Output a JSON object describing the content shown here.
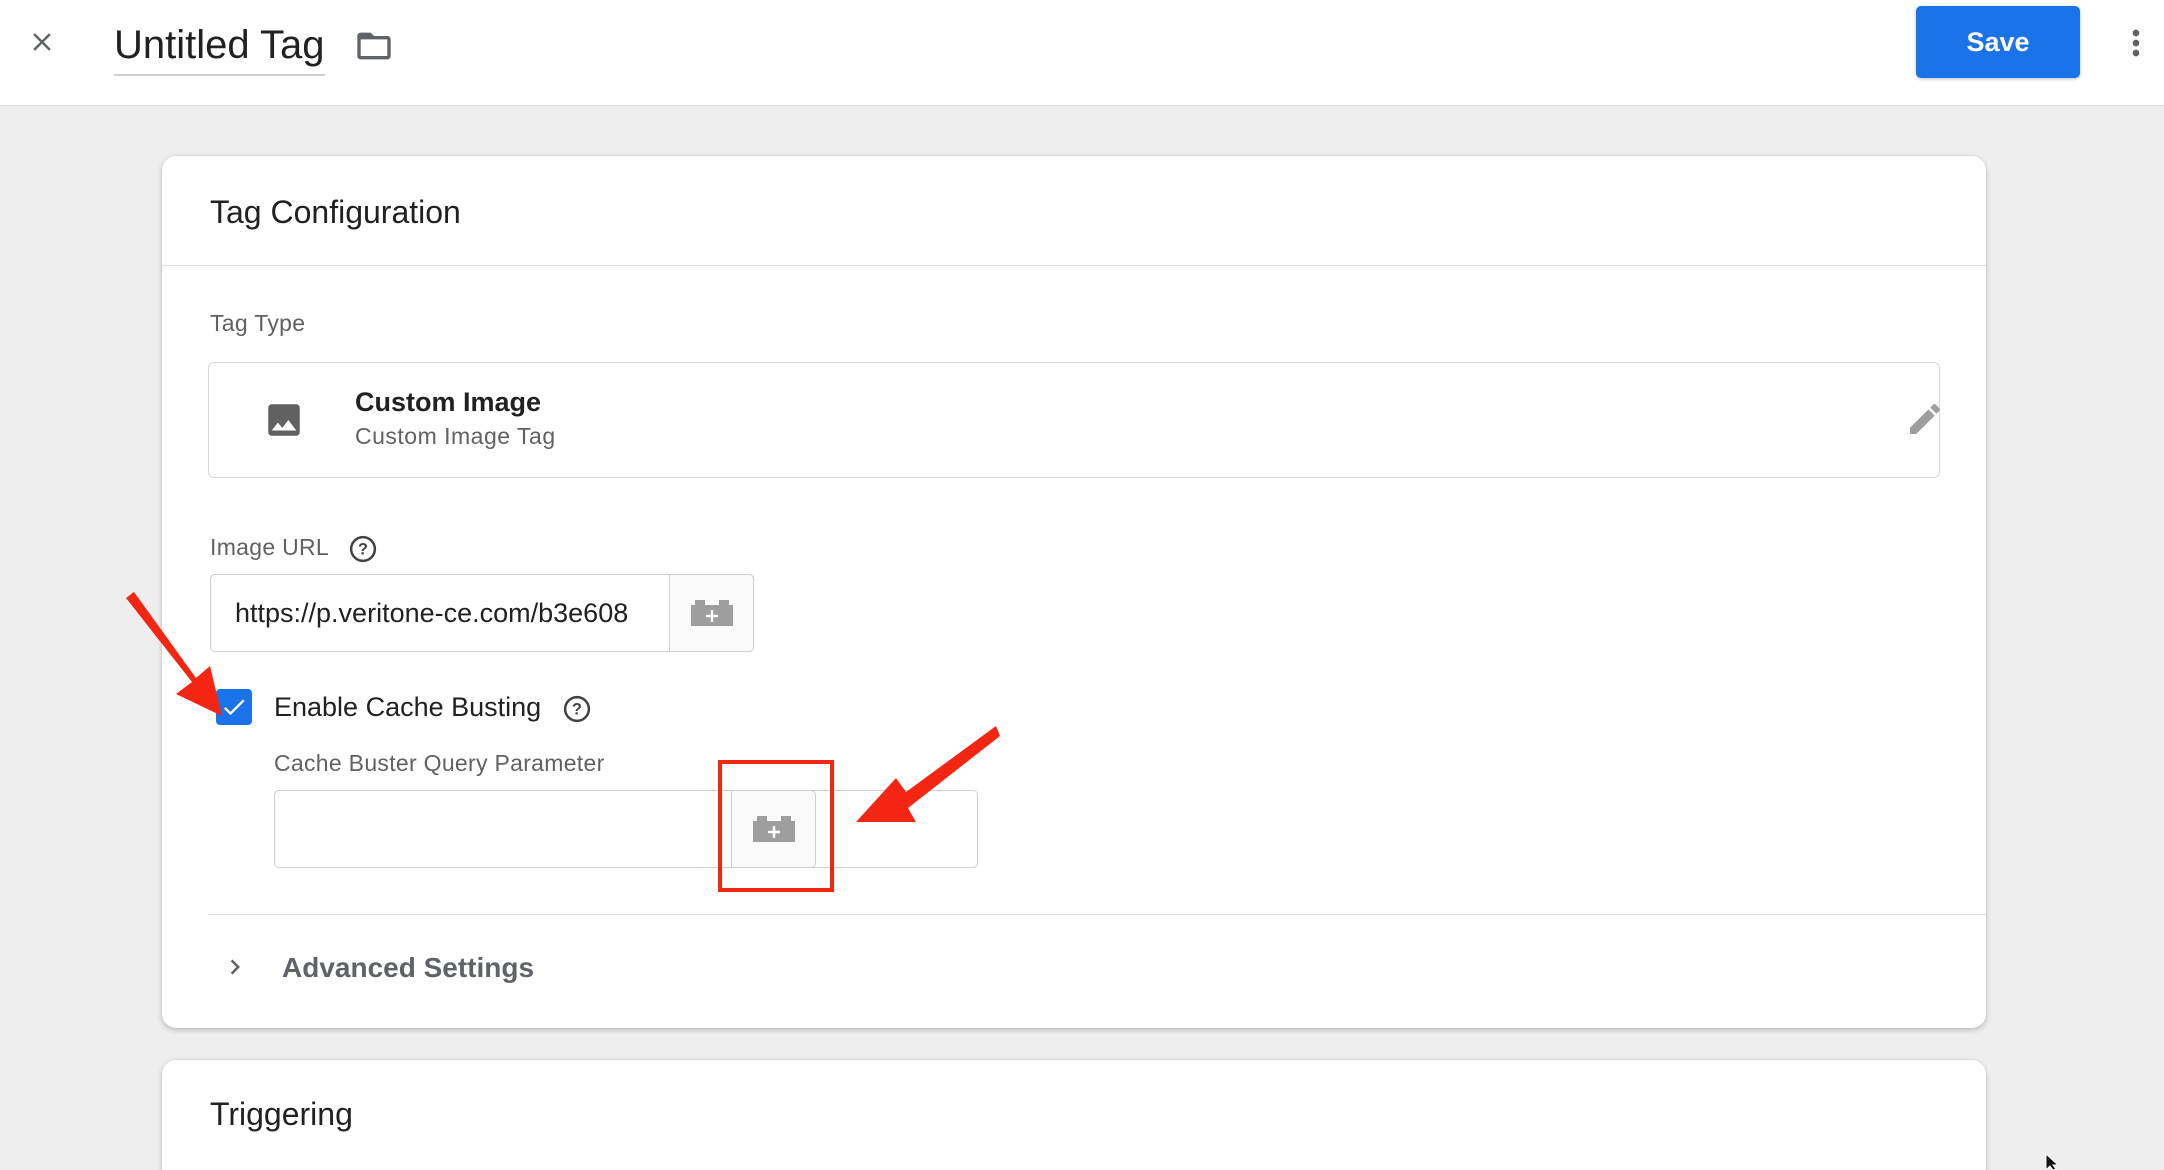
{
  "header": {
    "title": "Untitled Tag",
    "save_label": "Save"
  },
  "tag_configuration": {
    "title": "Tag Configuration",
    "tag_type_label": "Tag Type",
    "tag_type": {
      "name": "Custom Image",
      "description": "Custom Image Tag",
      "icon": "image-icon"
    },
    "image_url": {
      "label": "Image URL",
      "value": "https://p.veritone-ce.com/b3e608"
    },
    "cache_busting": {
      "label": "Enable Cache Busting",
      "checked": true,
      "query_param_label": "Cache Buster Query Parameter",
      "query_param_value": ""
    },
    "advanced_settings_label": "Advanced Settings"
  },
  "triggering": {
    "title": "Triggering"
  },
  "colors": {
    "accent": "#1a73e8",
    "annotation": "#f22613"
  }
}
